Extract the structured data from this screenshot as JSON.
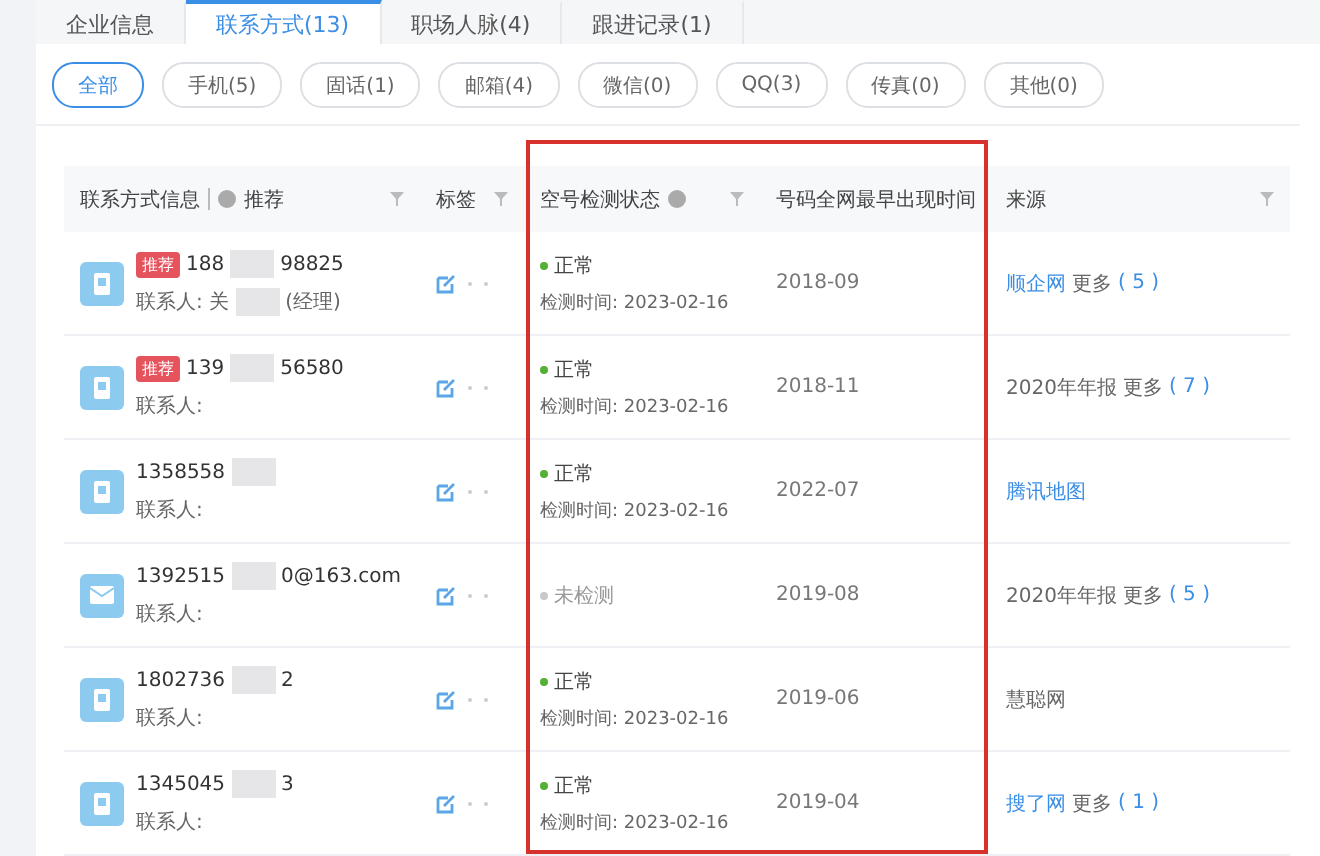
{
  "tabs": [
    {
      "label": "企业信息",
      "selected": false
    },
    {
      "label": "联系方式(13)",
      "selected": true
    },
    {
      "label": "职场人脉(4)",
      "selected": false
    },
    {
      "label": "跟进记录(1)",
      "selected": false
    }
  ],
  "filters": [
    {
      "label": "全部",
      "selected": true
    },
    {
      "label": "手机(5)",
      "selected": false
    },
    {
      "label": "固话(1)",
      "selected": false
    },
    {
      "label": "邮箱(4)",
      "selected": false
    },
    {
      "label": "微信(0)",
      "selected": false
    },
    {
      "label": "QQ(3)",
      "selected": false
    },
    {
      "label": "传真(0)",
      "selected": false
    },
    {
      "label": "其他(0)",
      "selected": false
    }
  ],
  "table": {
    "columns": [
      {
        "label": "联系方式信息",
        "extra": "推荐",
        "filter": true
      },
      {
        "label": "标签",
        "filter": true
      },
      {
        "label": "空号检测状态",
        "info": true,
        "filter": true
      },
      {
        "label": "号码全网最早出现时间",
        "filter": false
      },
      {
        "label": "来源",
        "filter": true
      }
    ],
    "rows": [
      {
        "kind": "phone",
        "badge": "推荐",
        "value_start": "188",
        "value_end": "98825",
        "contact": "联系人: 关",
        "contact_suffix": "(经理)",
        "status": {
          "kind": "normal",
          "label": "正常",
          "time": "检测时间: 2023-02-16"
        },
        "first_seen": "2018-09",
        "source": {
          "label": "顺企网",
          "link": true,
          "more": "更多",
          "count": "( 5 )"
        }
      },
      {
        "kind": "phone",
        "badge": "推荐",
        "value_start": "139",
        "value_end": "56580",
        "contact": "联系人:",
        "status": {
          "kind": "normal",
          "label": "正常",
          "time": "检测时间: 2023-02-16"
        },
        "first_seen": "2018-11",
        "source": {
          "label": "2020年年报",
          "link": false,
          "more": "更多",
          "count": "( 7 )"
        }
      },
      {
        "kind": "phone",
        "value_start": "1358558",
        "contact": "联系人:",
        "status": {
          "kind": "normal",
          "label": "正常",
          "time": "检测时间: 2023-02-16"
        },
        "first_seen": "2022-07",
        "source": {
          "label": "腾讯地图",
          "link": true
        }
      },
      {
        "kind": "email",
        "value_start": "1392515",
        "value_end": "0@163.com",
        "contact": "联系人:",
        "status": {
          "kind": "unchecked",
          "label": "未检测"
        },
        "first_seen": "2019-08",
        "source": {
          "label": "2020年年报",
          "link": false,
          "more": "更多",
          "count": "( 5 )"
        }
      },
      {
        "kind": "phone",
        "value_start": "1802736",
        "value_end": "2",
        "contact": "联系人:",
        "status": {
          "kind": "normal",
          "label": "正常",
          "time": "检测时间: 2023-02-16"
        },
        "first_seen": "2019-06",
        "source": {
          "label": "慧聪网",
          "link": false
        }
      },
      {
        "kind": "phone",
        "value_start": "1345045",
        "value_end": "3",
        "contact": "联系人:",
        "status": {
          "kind": "normal",
          "label": "正常",
          "time": "检测时间: 2023-02-16"
        },
        "first_seen": "2019-04",
        "source": {
          "label": "搜了网",
          "link": true,
          "more": "更多",
          "count": "( 1 )"
        }
      }
    ]
  }
}
